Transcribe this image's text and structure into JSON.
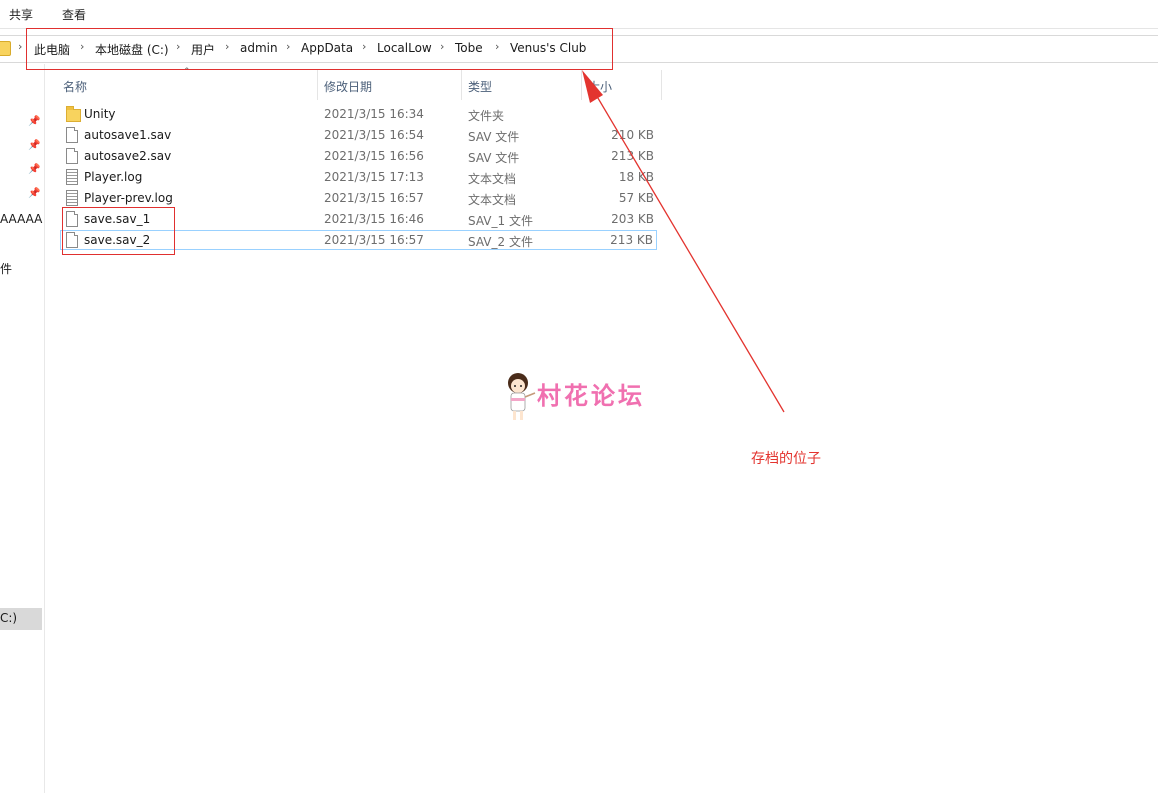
{
  "ribbon": {
    "tabs": [
      "共享",
      "查看"
    ]
  },
  "address": {
    "crumbs": [
      "此电脑",
      "本地磁盘 (C:)",
      "用户",
      "admin",
      "AppData",
      "LocalLow",
      "Tobe",
      "Venus's Club"
    ]
  },
  "nav": {
    "truncated_items": [
      "AAAAA",
      "件",
      "C:)"
    ]
  },
  "columns": {
    "name": "名称",
    "date": "修改日期",
    "type": "类型",
    "size": "大小"
  },
  "files": [
    {
      "name": "Unity",
      "date": "2021/3/15 16:34",
      "type": "文件夹",
      "size": "",
      "icon": "folder-icon"
    },
    {
      "name": "autosave1.sav",
      "date": "2021/3/15 16:54",
      "type": "SAV 文件",
      "size": "210 KB",
      "icon": "file-icon"
    },
    {
      "name": "autosave2.sav",
      "date": "2021/3/15 16:56",
      "type": "SAV 文件",
      "size": "213 KB",
      "icon": "file-icon"
    },
    {
      "name": "Player.log",
      "date": "2021/3/15 17:13",
      "type": "文本文档",
      "size": "18 KB",
      "icon": "text-file-icon"
    },
    {
      "name": "Player-prev.log",
      "date": "2021/3/15 16:57",
      "type": "文本文档",
      "size": "57 KB",
      "icon": "text-file-icon"
    },
    {
      "name": "save.sav_1",
      "date": "2021/3/15 16:46",
      "type": "SAV_1 文件",
      "size": "203 KB",
      "icon": "file-icon"
    },
    {
      "name": "save.sav_2",
      "date": "2021/3/15 16:57",
      "type": "SAV_2 文件",
      "size": "213 KB",
      "icon": "file-icon"
    }
  ],
  "annotation": {
    "label": "存档的位子",
    "color": "#e3342f"
  },
  "watermark": {
    "text": "村花论坛",
    "color": "#f070b0"
  }
}
